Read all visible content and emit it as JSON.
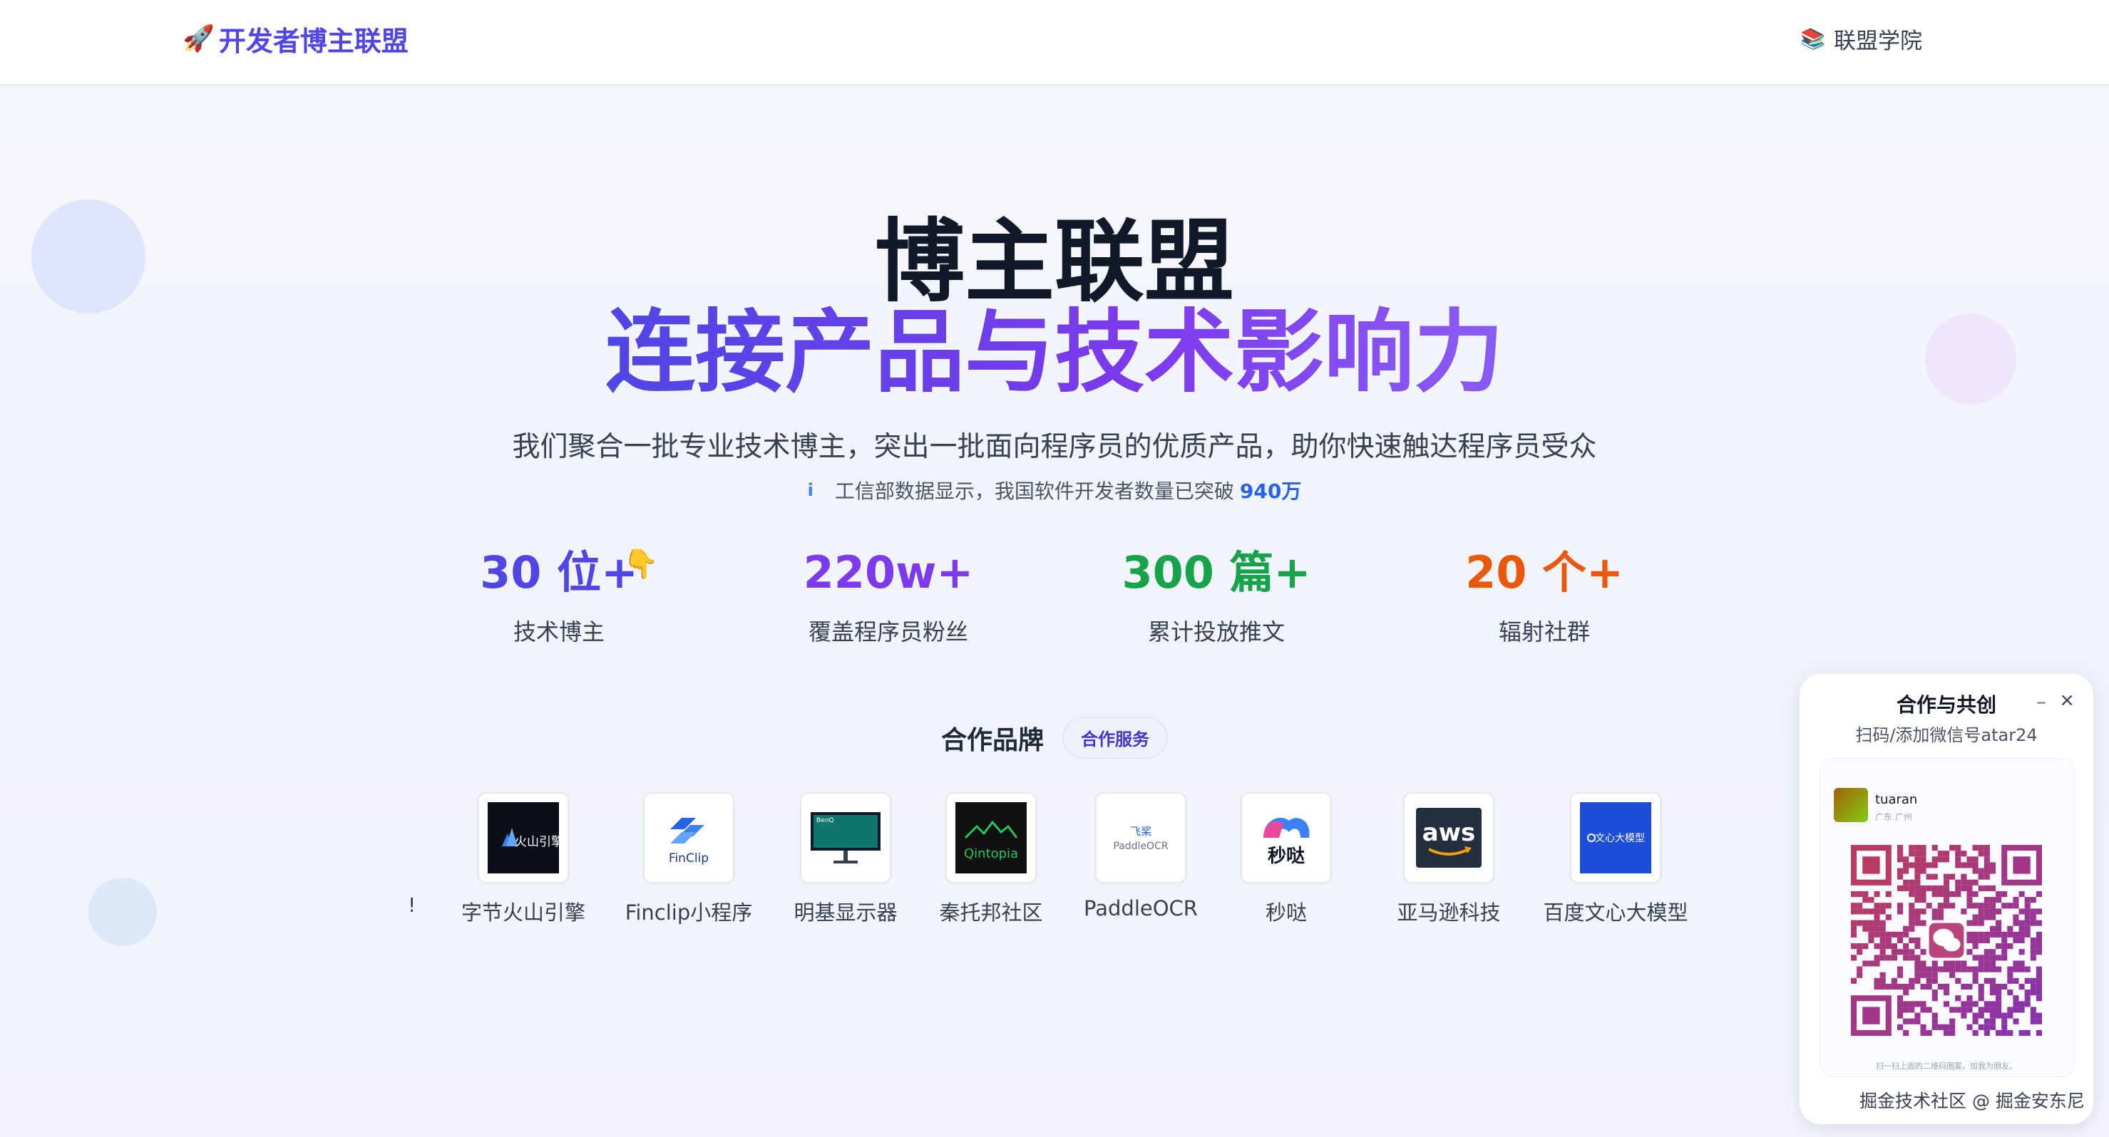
{
  "nav": {
    "brand_emoji": "🚀",
    "brand_text": "开发者博主联盟",
    "academy_emoji": "📚",
    "academy_label": "联盟学院"
  },
  "hero": {
    "title": "博主联盟",
    "subtitle": "连接产品与技术影响力",
    "tagline": "我们聚合一批专业技术博主，突出一批面向程序员的优质产品，助你快速触达程序员受众",
    "notice_icon": "i",
    "notice_text": "工信部数据显示，我国软件开发者数量已突破",
    "notice_number": "940万"
  },
  "stats": [
    {
      "value": "30 位+",
      "label": "技术博主",
      "color": "#4f46e5"
    },
    {
      "value": "220w+",
      "label": "覆盖程序员粉丝",
      "color": "#7c3aed"
    },
    {
      "value": "300 篇+",
      "label": "累计投放推文",
      "color": "#16a34a"
    },
    {
      "value": "20 个+",
      "label": "辐射社群",
      "color": "#ea580c"
    }
  ],
  "stats_hand": "👇",
  "partners": {
    "title": "合作品牌",
    "service_label": "合作服务",
    "stray_text": "!",
    "brands": [
      {
        "name": "字节火山引擎",
        "logo_text": "火山引擎",
        "logo_icon": "volcano-engine-logo"
      },
      {
        "name": "Finclip小程序",
        "logo_text": "FinClip",
        "logo_icon": "finclip-logo"
      },
      {
        "name": "明基显示器",
        "logo_text": "BenQ",
        "logo_icon": "benq-monitor-logo"
      },
      {
        "name": "秦托邦社区",
        "logo_text": "Qintopia",
        "logo_icon": "qintopia-logo"
      },
      {
        "name": "PaddleOCR",
        "logo_text": "飞桨",
        "logo_text2": "PaddleOCR",
        "logo_icon": "paddleocr-logo"
      },
      {
        "name": "秒哒",
        "logo_text": "秒哒",
        "logo_icon": "miaoda-logo"
      },
      {
        "name": "亚马逊科技",
        "logo_text": "aws",
        "logo_icon": "aws-logo"
      },
      {
        "name": "百度文心大模型",
        "logo_text": "文心大模型",
        "logo_icon": "wenxin-logo"
      }
    ]
  },
  "contact": {
    "title": "合作与共创",
    "subtitle": "扫码/添加微信号atar24",
    "minimize": "–",
    "close": "×",
    "user_name": "tuaran",
    "user_location": "广东 广州",
    "scan_hint": "扫一扫上面的二维码图案，加我为朋友。",
    "watermark": "掘金技术社区 @ 掘金安东尼"
  }
}
